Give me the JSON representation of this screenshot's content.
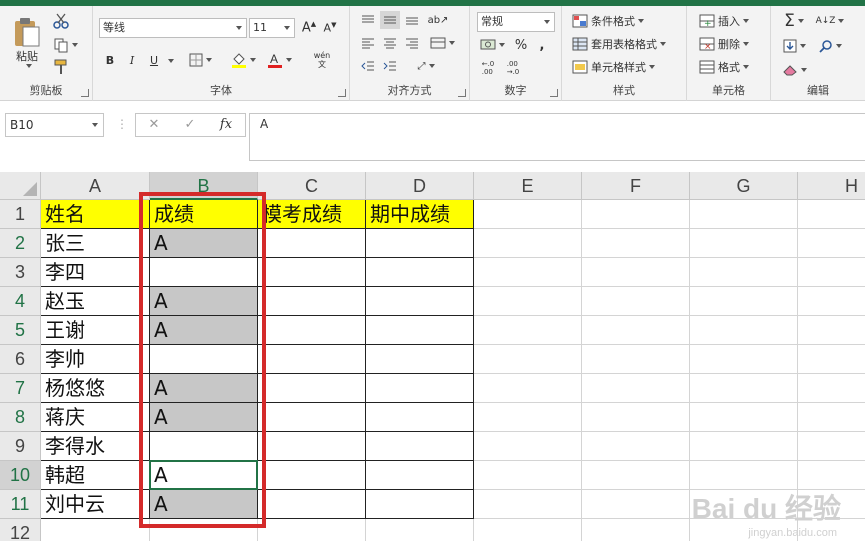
{
  "ribbon": {
    "clipboard": {
      "label": "剪贴板",
      "paste_label": "粘贴"
    },
    "font": {
      "label": "字体",
      "font_name": "等线",
      "font_size": "11",
      "bold": "B",
      "italic": "I",
      "underline": "U",
      "wen": "wén\n文"
    },
    "alignment": {
      "label": "对齐方式"
    },
    "number": {
      "label": "数字",
      "format": "常规",
      "percent": "%",
      "comma": ",",
      "inc_decimal": "←.0\n.00",
      "dec_decimal": ".00\n→.0"
    },
    "styles": {
      "label": "样式",
      "conditional": "条件格式",
      "table_format": "套用表格格式",
      "cell_styles": "单元格样式"
    },
    "cells": {
      "label": "单元格",
      "insert": "插入",
      "delete": "删除",
      "format": "格式"
    },
    "editing": {
      "label": "编辑"
    }
  },
  "formula_bar": {
    "name_box": "B10",
    "formula": "A",
    "cancel": "✕",
    "enter": "✓",
    "fx": "fx"
  },
  "columns": [
    "A",
    "B",
    "C",
    "D",
    "E",
    "F",
    "G",
    "H"
  ],
  "rows": [
    {
      "num": "1",
      "a": "姓名",
      "b": "成绩",
      "c": "模考成绩",
      "d": "期中成绩"
    },
    {
      "num": "2",
      "a": "张三",
      "b": "A",
      "c": "",
      "d": ""
    },
    {
      "num": "3",
      "a": "李四",
      "b": "",
      "c": "",
      "d": ""
    },
    {
      "num": "4",
      "a": "赵玉",
      "b": "A",
      "c": "",
      "d": ""
    },
    {
      "num": "5",
      "a": "王谢",
      "b": "A",
      "c": "",
      "d": ""
    },
    {
      "num": "6",
      "a": "李帅",
      "b": "",
      "c": "",
      "d": ""
    },
    {
      "num": "7",
      "a": "杨悠悠",
      "b": "A",
      "c": "",
      "d": ""
    },
    {
      "num": "8",
      "a": "蒋庆",
      "b": "A",
      "c": "",
      "d": ""
    },
    {
      "num": "9",
      "a": "李得水",
      "b": "",
      "c": "",
      "d": ""
    },
    {
      "num": "10",
      "a": "韩超",
      "b": "A",
      "c": "",
      "d": ""
    },
    {
      "num": "11",
      "a": "刘中云",
      "b": "A",
      "c": "",
      "d": ""
    },
    {
      "num": "12",
      "a": "",
      "b": "",
      "c": "",
      "d": ""
    }
  ],
  "watermark": {
    "main": "Bai du 经验",
    "sub": "jingyan.baidu.com"
  },
  "colors": {
    "excel_green": "#217346",
    "header_fill": "#ffff00",
    "gray_fill": "#c7c7c7",
    "annotation_red": "#d42a2a"
  }
}
